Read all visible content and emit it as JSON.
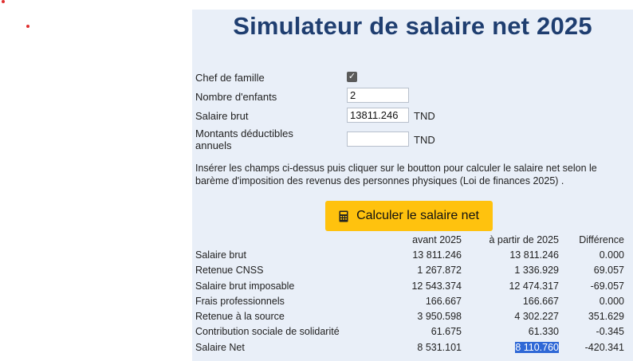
{
  "header": {
    "title": "Simulateur de salaire net 2025"
  },
  "form": {
    "chef_label": "Chef de famille",
    "chef_checked": true,
    "enfants_label": "Nombre d'enfants",
    "enfants_value": "2",
    "brut_label": "Salaire brut",
    "brut_value": "13811.246",
    "brut_unit": "TND",
    "deduct_label_line1": "Montants déductibles",
    "deduct_label_line2": "annuels",
    "deduct_value": "",
    "deduct_unit": "TND"
  },
  "instructions": "Insérer les champs ci-dessus puis cliquer sur le boutton pour calculer le salaire net selon le barème d'imposition des revenus des personnes physiques (Loi de finances 2025) .",
  "button": {
    "label": "Calculer le salaire net",
    "icon": "calculator-icon"
  },
  "results": {
    "headers": [
      "",
      "avant 2025",
      "à partir de 2025",
      "Différence"
    ],
    "rows": [
      [
        "Salaire brut",
        "13 811.246",
        "13 811.246",
        "0.000"
      ],
      [
        "Retenue CNSS",
        "1 267.872",
        "1 336.929",
        "69.057"
      ],
      [
        "Salaire brut imposable",
        "12 543.374",
        "12 474.317",
        "-69.057"
      ],
      [
        "Frais professionnels",
        "166.667",
        "166.667",
        "0.000"
      ],
      [
        "Retenue à la source",
        "3 950.598",
        "4 302.227",
        "351.629"
      ],
      [
        "Contribution sociale de solidarité",
        "61.675",
        "61.330",
        "-0.345"
      ],
      [
        "Salaire Net",
        "8 531.101",
        "8 110.760",
        "-420.341"
      ]
    ]
  },
  "colors": {
    "title": "#1f3e70",
    "panel_bg": "#e9eff8",
    "button_bg": "#ffc20e",
    "selection": "#2f68d6"
  }
}
